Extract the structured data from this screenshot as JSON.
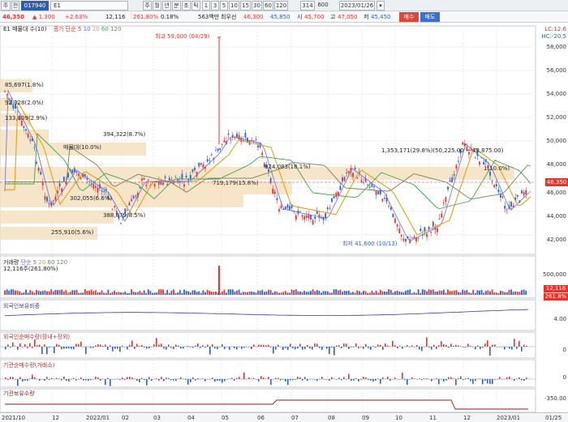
{
  "toolbar": {
    "buttons": [
      "주",
      "전",
      "017940",
      "E1",
      "주",
      "월",
      "년",
      "분",
      "초",
      "틱",
      "1",
      "3",
      "5",
      "10",
      "15",
      "30",
      "60",
      "120",
      "314",
      "600",
      "2023/01/26"
    ],
    "selected": "017940"
  },
  "quote": {
    "price": "46,350",
    "change": "▲ 1,300",
    "change_pct": "+2.63%",
    "volume": "12,116",
    "volume_pct": "261.80%",
    "turnover": "0.18%",
    "amount": "563백만",
    "label_best": "최우선",
    "best": "46,300",
    "ask": "45,850",
    "open_label": "시",
    "open": "45,700",
    "high_label": "고",
    "high": "47,050",
    "low_label": "저",
    "low": "45,450",
    "buy": "매수",
    "sell": "매도"
  },
  "price_panel": {
    "legend_name": "E1 매물대 수(10)",
    "ma_legend": [
      "종가 단순 5",
      "10",
      "20",
      "60",
      "120"
    ],
    "yaxis": [
      "58,000",
      "56,000",
      "54,000",
      "52,000",
      "50,000",
      "48,000",
      "46,000",
      "44,000",
      "42,000"
    ],
    "right_top": [
      "LC:12.6",
      "HC:-20.5"
    ],
    "current_badge": "46,350",
    "high_note": "최고 59,000 (04/29)",
    "low_note": "최저 41,600 (10/13)",
    "vp_labels": [
      "85,697(1.8%)",
      "92,328(2.0%)",
      "133,809(2.9%)",
      "394,322(8.7%)",
      "매물대(10.0%)",
      "302,055(6.6%)",
      "388,879(8.5%)",
      "255,910(5.6%)",
      "719,179(15.8%)",
      "824,083(18.1%)",
      "1,353,171(29.8%)(50,225.00 ~ 48,875.00)",
      "1(10.0%)"
    ]
  },
  "volume_panel": {
    "legend": [
      "거래량",
      "단순 5",
      "20",
      "60",
      "120"
    ],
    "sub": "12,116주(261.80%)",
    "yaxis": [
      "500,000",
      "0"
    ],
    "badges": [
      "12,116",
      "261.8%"
    ]
  },
  "foreign_ratio_panel": {
    "legend": "외국인보유비중",
    "yaxis": [
      "4.00"
    ]
  },
  "foreign_net_panel": {
    "legend": "외국인순매수량(장내+장외)",
    "yaxis": [
      "0"
    ]
  },
  "inst_net_panel": {
    "legend": "기관순매수량(거래소)",
    "yaxis": [
      "0"
    ]
  },
  "inst_hold_panel": {
    "legend": "기관보유수량",
    "yaxis": [
      "-350.00"
    ]
  },
  "xaxis": [
    "2021/10",
    "12",
    "2022/01",
    "02",
    "03",
    "04",
    "05",
    "06",
    "07",
    "08",
    "09",
    "10",
    "11",
    "12",
    "2023/01",
    "01/25"
  ],
  "colors": {
    "up": "#e8332c",
    "down": "#2b5fd6",
    "ma5": "#6a6ad8",
    "ma20": "#e0a21a",
    "ma60": "#3aa64a",
    "ma120": "#7d7f58",
    "volume_profile": "#f3dcb6"
  }
}
